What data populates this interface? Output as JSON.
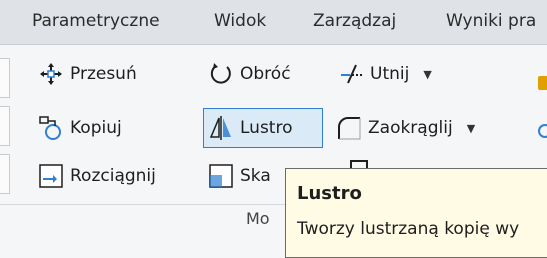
{
  "tabs": [
    "Parametryczne",
    "Widok",
    "Zarządzaj",
    "Wyniki pra"
  ],
  "tools": {
    "przesun": "Przesuń",
    "obroc": "Obróć",
    "utnij": "Utnij",
    "kopiuj": "Kopiuj",
    "lustro": "Lustro",
    "zaokraglij": "Zaokrąglij",
    "rozciagnij": "Rozciągnij",
    "skala": "Ska"
  },
  "panel_label": "Mo",
  "tooltip": {
    "title": "Lustro",
    "body": "Tworzy lustrzaną kopię wy"
  },
  "colors": {
    "accent": "#2f7fd4",
    "selected_bg": "#dbeaf7",
    "tooltip_bg": "#fffbe5"
  }
}
